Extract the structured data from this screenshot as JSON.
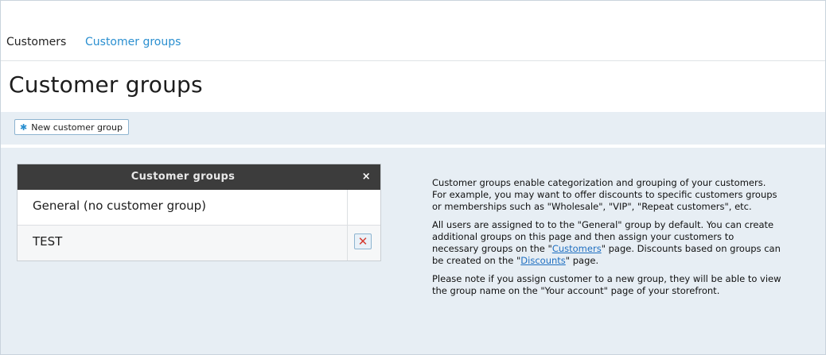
{
  "tabs": [
    {
      "label": "Customers"
    },
    {
      "label": "Customer groups"
    }
  ],
  "page_title": "Customer groups",
  "toolbar": {
    "new_button_icon": "asterisk-icon",
    "new_button_label": "New customer group"
  },
  "groups_table": {
    "header": "Customer groups",
    "close_glyph": "×",
    "rows": [
      {
        "name": "General (no customer group)",
        "deletable": false
      },
      {
        "name": "TEST",
        "deletable": true,
        "delete_glyph": "✕"
      }
    ]
  },
  "help": {
    "p1": "Customer groups enable categorization and grouping of your customers. For example, you may want to offer discounts to specific customers groups or memberships such as \"Wholesale\", \"VIP\", \"Repeat customers\", etc.",
    "p2_a": "All users are assigned to to the \"General\" group by default. You can create additional groups on this page and then assign your customers to necessary groups on the \"",
    "p2_link1": "Customers",
    "p2_b": "\" page. Discounts based on groups can be created on the \"",
    "p2_link2": "Discounts",
    "p2_c": "\" page.",
    "p3": "Please note if you assign customer to a new group, they will be able to view the group name on the \"Your account\" page of your storefront."
  },
  "colors": {
    "accent": "#2a8fd0",
    "panel_bg": "#e7eef4",
    "table_header_bg": "#3c3c3c",
    "delete_red": "#d43a2f"
  }
}
